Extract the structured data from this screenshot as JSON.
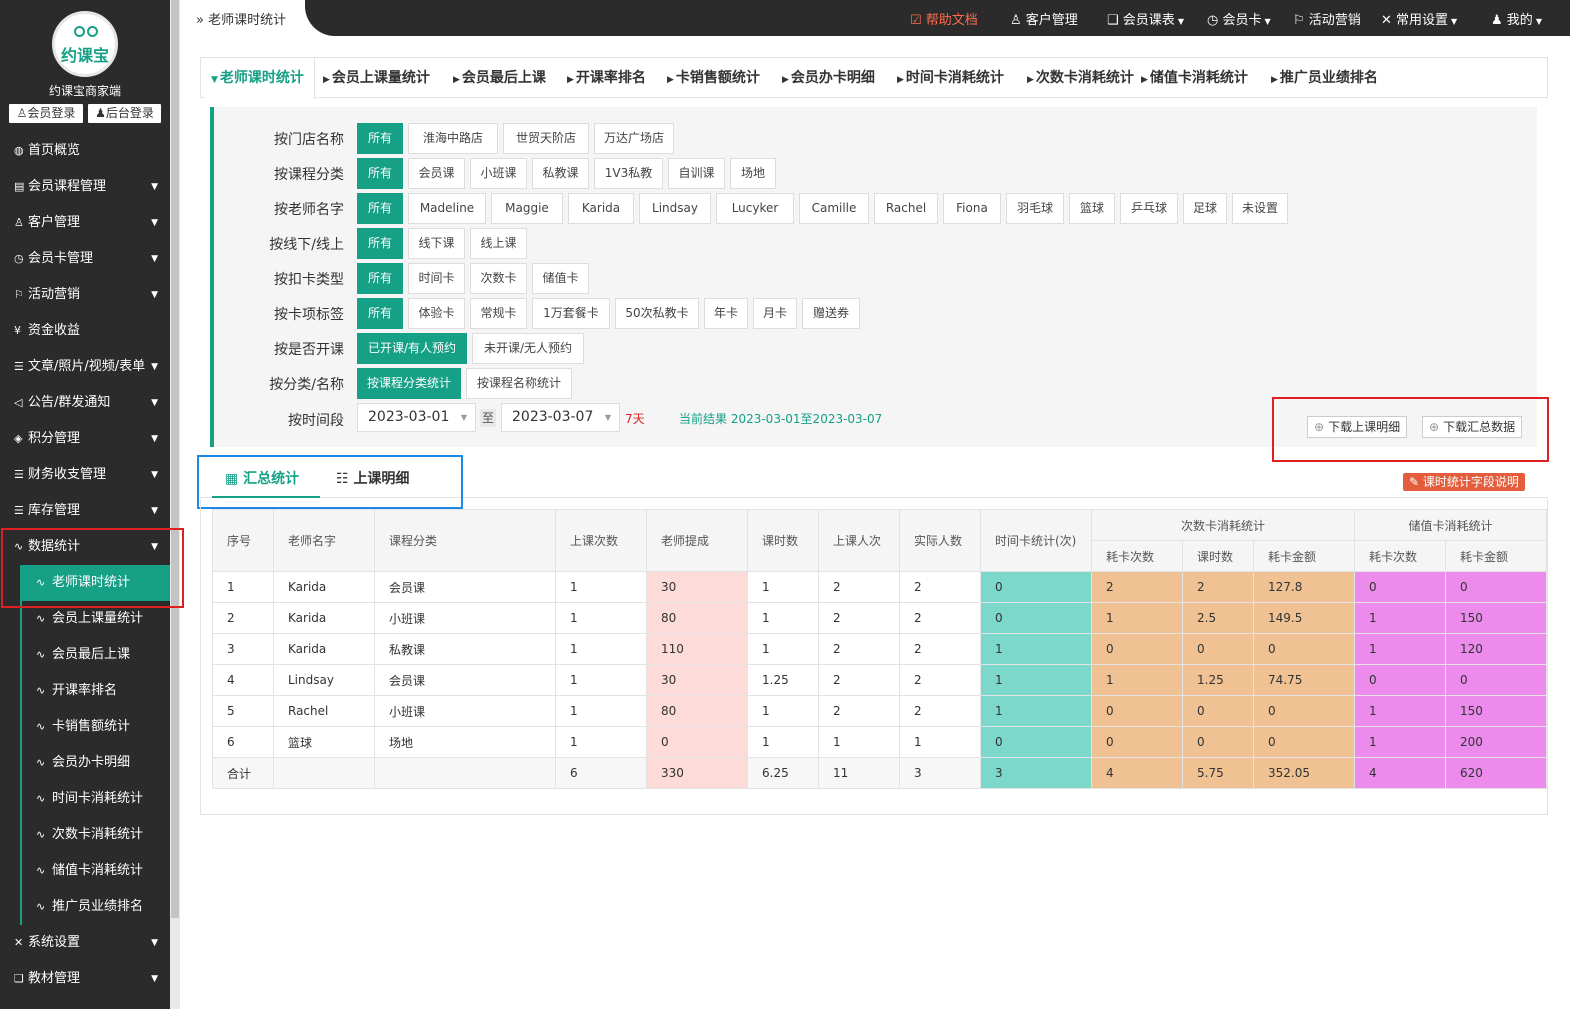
{
  "brand": {
    "logo_text": "约课宝",
    "name": "约课宝商家端",
    "member_login": "会员登录",
    "admin_login": "后台登录"
  },
  "sidebar": {
    "items": [
      {
        "label": "首页概览",
        "icon": "globe-icon",
        "glyph": "◍",
        "caret": false
      },
      {
        "label": "会员课程管理",
        "icon": "document-icon",
        "glyph": "▤",
        "caret": true
      },
      {
        "label": "客户管理",
        "icon": "user-icon",
        "glyph": "♙",
        "caret": true
      },
      {
        "label": "会员卡管理",
        "icon": "clock-icon",
        "glyph": "◷",
        "caret": true
      },
      {
        "label": "活动营销",
        "icon": "flag-icon",
        "glyph": "⚐",
        "caret": true
      },
      {
        "label": "资金收益",
        "icon": "yen-icon",
        "glyph": "¥",
        "caret": false
      },
      {
        "label": "文章/照片/视频/表单",
        "icon": "sliders-icon",
        "glyph": "☰",
        "caret": true
      },
      {
        "label": "公告/群发通知",
        "icon": "megaphone-icon",
        "glyph": "◁",
        "caret": true
      },
      {
        "label": "积分管理",
        "icon": "diamond-icon",
        "glyph": "◈",
        "caret": true
      },
      {
        "label": "财务收支管理",
        "icon": "sliders-icon",
        "glyph": "☰",
        "caret": true
      },
      {
        "label": "库存管理",
        "icon": "sliders-icon",
        "glyph": "☰",
        "caret": true
      },
      {
        "label": "数据统计",
        "icon": "pulse-icon",
        "glyph": "∿",
        "caret": true
      }
    ],
    "sub_items": [
      "老师课时统计",
      "会员上课量统计",
      "会员最后上课",
      "开课率排名",
      "卡销售额统计",
      "会员办卡明细",
      "时间卡消耗统计",
      "次数卡消耗统计",
      "储值卡消耗统计",
      "推广员业绩排名"
    ],
    "bottom_items": [
      {
        "label": "系统设置",
        "icon": "wrench-icon",
        "glyph": "✕"
      },
      {
        "label": "教材管理",
        "icon": "book-icon",
        "glyph": "❑"
      }
    ]
  },
  "topbar": {
    "breadcrumb": "老师课时统计",
    "links": [
      "帮助文档",
      "客户管理",
      "会员课表",
      "会员卡",
      "活动营销",
      "常用设置",
      "我的"
    ]
  },
  "tabs": [
    "老师课时统计",
    "会员上课量统计",
    "会员最后上课",
    "开课率排名",
    "卡销售额统计",
    "会员办卡明细",
    "时间卡消耗统计",
    "次数卡消耗统计",
    "储值卡消耗统计",
    "推广员业绩排名"
  ],
  "filters": {
    "store": {
      "label": "按门店名称",
      "options": [
        "所有",
        "淮海中路店",
        "世贸天阶店",
        "万达广场店"
      ]
    },
    "course_cat": {
      "label": "按课程分类",
      "options": [
        "所有",
        "会员课",
        "小班课",
        "私教课",
        "1V3私教",
        "自训课",
        "场地"
      ]
    },
    "teacher": {
      "label": "按老师名字",
      "options": [
        "所有",
        "Madeline",
        "Maggie",
        "Karida",
        "Lindsay",
        "Lucyker",
        "Camille",
        "Rachel",
        "Fiona",
        "羽毛球",
        "篮球",
        "乒乓球",
        "足球",
        "未设置"
      ]
    },
    "online": {
      "label": "按线下/线上",
      "options": [
        "所有",
        "线下课",
        "线上课"
      ]
    },
    "card_type": {
      "label": "按扣卡类型",
      "options": [
        "所有",
        "时间卡",
        "次数卡",
        "储值卡"
      ]
    },
    "card_tag": {
      "label": "按卡项标签",
      "options": [
        "所有",
        "体验卡",
        "常规卡",
        "1万套餐卡",
        "50次私教卡",
        "年卡",
        "月卡",
        "赠送券"
      ]
    },
    "opened": {
      "label": "按是否开课",
      "options": [
        "已开课/有人预约",
        "未开课/无人预约"
      ]
    },
    "group_by": {
      "label": "按分类/名称",
      "options": [
        "按课程分类统计",
        "按课程名称统计"
      ]
    },
    "period": {
      "label": "按时间段",
      "start": "2023-03-01",
      "to": "至",
      "end": "2023-03-07",
      "days": "7天",
      "result": "当前结果 2023-03-01至2023-03-07"
    },
    "download_detail": "下载上课明细",
    "download_summary": "下载汇总数据"
  },
  "subtabs": {
    "summary": "汇总统计",
    "detail": "上课明细",
    "field_help": "课时统计字段说明"
  },
  "table": {
    "headers": {
      "no": "序号",
      "teacher": "老师名字",
      "category": "课程分类",
      "sessions": "上课次数",
      "commission": "老师提成",
      "hours": "课时数",
      "attendance": "上课人次",
      "actual": "实际人数",
      "time_card": "时间卡统计(次)",
      "count_group": "次数卡消耗统计",
      "count_times": "耗卡次数",
      "count_hours": "课时数",
      "count_amount": "耗卡金额",
      "stored_group": "储值卡消耗统计",
      "stored_times": "耗卡次数",
      "stored_amount": "耗卡金额"
    },
    "rows": [
      [
        "1",
        "Karida",
        "会员课",
        "1",
        "30",
        "1",
        "2",
        "2",
        "0",
        "2",
        "2",
        "127.8",
        "0",
        "0"
      ],
      [
        "2",
        "Karida",
        "小班课",
        "1",
        "80",
        "1",
        "2",
        "2",
        "0",
        "1",
        "2.5",
        "149.5",
        "1",
        "150"
      ],
      [
        "3",
        "Karida",
        "私教课",
        "1",
        "110",
        "1",
        "2",
        "2",
        "1",
        "0",
        "0",
        "0",
        "1",
        "120"
      ],
      [
        "4",
        "Lindsay",
        "会员课",
        "1",
        "30",
        "1.25",
        "2",
        "2",
        "1",
        "1",
        "1.25",
        "74.75",
        "0",
        "0"
      ],
      [
        "5",
        "Rachel",
        "小班课",
        "1",
        "80",
        "1",
        "2",
        "2",
        "1",
        "0",
        "0",
        "0",
        "1",
        "150"
      ],
      [
        "6",
        "篮球",
        "场地",
        "1",
        "0",
        "1",
        "1",
        "1",
        "0",
        "0",
        "0",
        "0",
        "1",
        "200"
      ]
    ],
    "total": [
      "合计",
      "",
      "",
      "6",
      "330",
      "6.25",
      "11",
      "3",
      "3",
      "4",
      "5.75",
      "352.05",
      "4",
      "620"
    ]
  },
  "colors": {
    "accent": "#16a085",
    "sidebar_bg": "#2b2b2b",
    "time_card_col": "#7cd8cb",
    "count_card_col": "#f0c293",
    "stored_card_col": "#ec8bec",
    "commission_col": "#fcdbd8"
  }
}
